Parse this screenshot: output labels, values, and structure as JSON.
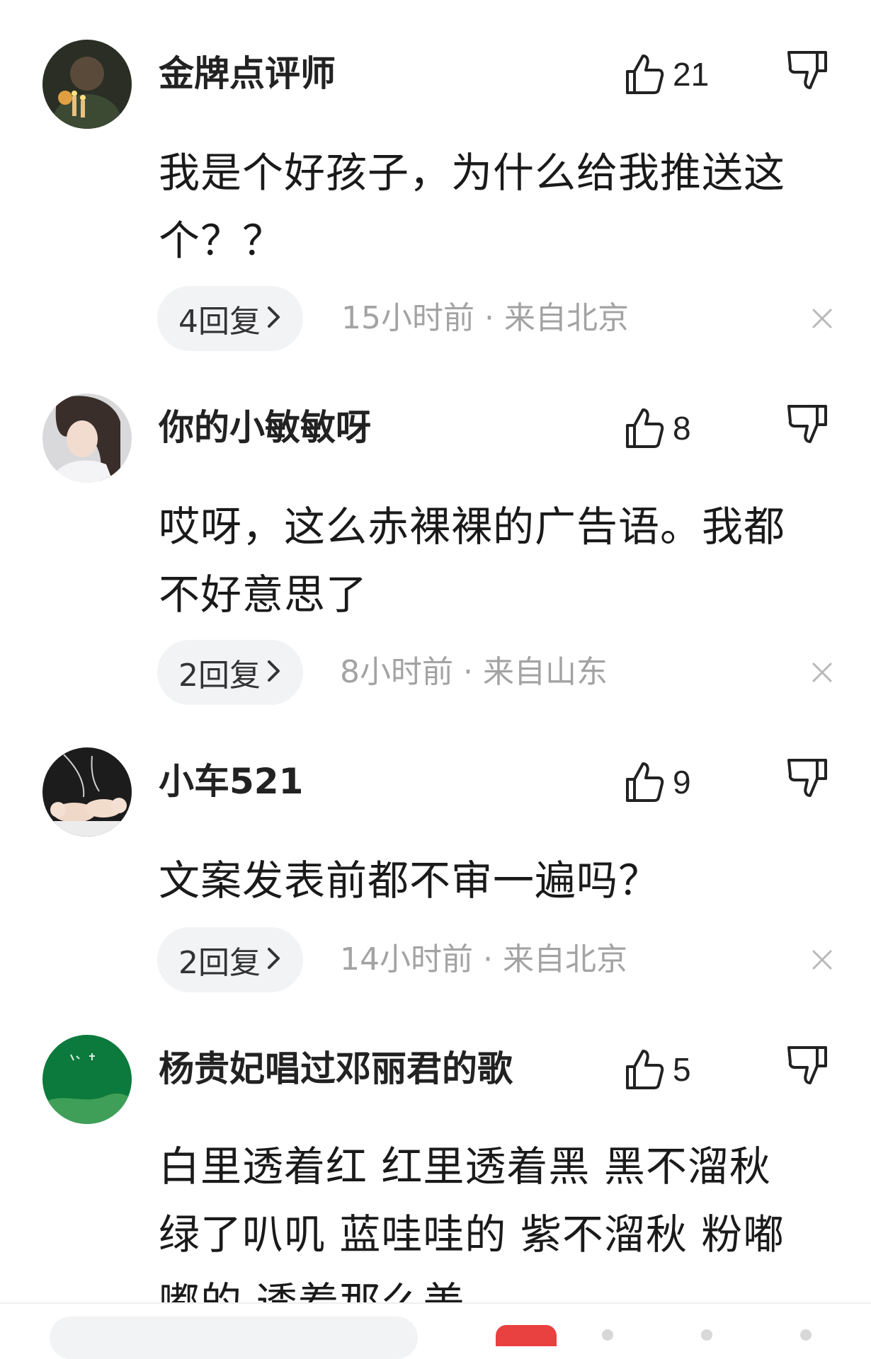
{
  "comments": [
    {
      "username": "金牌点评师",
      "likes": "21",
      "content_lines": [
        "我是个好孩子，为什么给我推送这",
        "个？？"
      ],
      "reply_label": "4回复",
      "meta": "15小时前 · 来自北京",
      "avatar_icon": "avatar-candles"
    },
    {
      "username": "你的小敏敏呀",
      "likes": "8",
      "content_lines": [
        "哎呀，这么赤裸裸的广告语。我都",
        "不好意思了"
      ],
      "reply_label": "2回复",
      "meta": "8小时前 · 来自山东",
      "avatar_icon": "avatar-girl"
    },
    {
      "username": "小车521",
      "likes": "9",
      "content_lines": [
        "文案发表前都不审一遍吗？"
      ],
      "reply_label": "2回复",
      "meta": "14小时前 · 来自北京",
      "avatar_icon": "avatar-babies"
    },
    {
      "username": "杨贵妃唱过邓丽君的歌",
      "likes": "5",
      "content_lines": [
        "白里透着红 红里透着黑 黑不溜秋",
        "绿了叭叽 蓝哇哇的 紫不溜秋 粉嘟",
        "嘟的 透着那么美"
      ],
      "avatar_icon": "avatar-green"
    }
  ],
  "colors": {
    "text": "#1a1a1a",
    "meta": "#a3a3a3",
    "pill_bg": "#f2f3f5",
    "badge": "#e94040"
  }
}
